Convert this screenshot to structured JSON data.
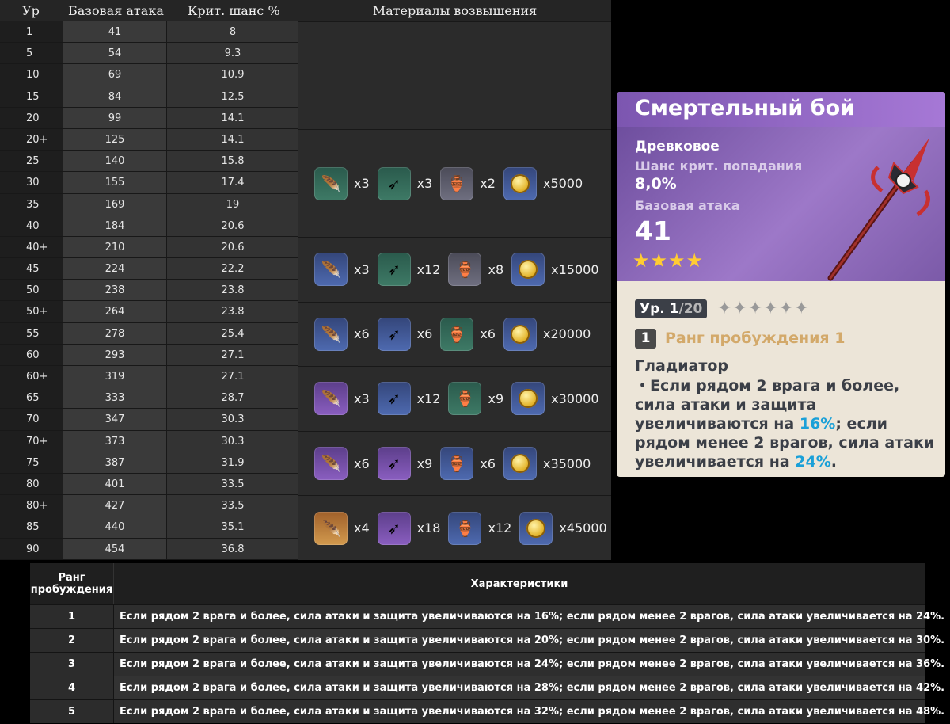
{
  "stats": {
    "headers": {
      "level": "Ур",
      "atk": "Базовая атака",
      "crit": "Крит. шанс %",
      "mats": "Материалы возвышения"
    },
    "rows": [
      {
        "lvl": "1",
        "atk": "41",
        "crit": "8"
      },
      {
        "lvl": "5",
        "atk": "54",
        "crit": "9.3"
      },
      {
        "lvl": "10",
        "atk": "69",
        "crit": "10.9"
      },
      {
        "lvl": "15",
        "atk": "84",
        "crit": "12.5"
      },
      {
        "lvl": "20",
        "atk": "99",
        "crit": "14.1"
      },
      {
        "lvl": "20+",
        "atk": "125",
        "crit": "14.1"
      },
      {
        "lvl": "25",
        "atk": "140",
        "crit": "15.8"
      },
      {
        "lvl": "30",
        "atk": "155",
        "crit": "17.4"
      },
      {
        "lvl": "35",
        "atk": "169",
        "crit": "19"
      },
      {
        "lvl": "40",
        "atk": "184",
        "crit": "20.6"
      },
      {
        "lvl": "40+",
        "atk": "210",
        "crit": "20.6"
      },
      {
        "lvl": "45",
        "atk": "224",
        "crit": "22.2"
      },
      {
        "lvl": "50",
        "atk": "238",
        "crit": "23.8"
      },
      {
        "lvl": "50+",
        "atk": "264",
        "crit": "23.8"
      },
      {
        "lvl": "55",
        "atk": "278",
        "crit": "25.4"
      },
      {
        "lvl": "60",
        "atk": "293",
        "crit": "27.1"
      },
      {
        "lvl": "60+",
        "atk": "319",
        "crit": "27.1"
      },
      {
        "lvl": "65",
        "atk": "333",
        "crit": "28.7"
      },
      {
        "lvl": "70",
        "atk": "347",
        "crit": "30.3"
      },
      {
        "lvl": "70+",
        "atk": "373",
        "crit": "30.3"
      },
      {
        "lvl": "75",
        "atk": "387",
        "crit": "31.9"
      },
      {
        "lvl": "80",
        "atk": "401",
        "crit": "33.5"
      },
      {
        "lvl": "80+",
        "atk": "427",
        "crit": "33.5"
      },
      {
        "lvl": "85",
        "atk": "440",
        "crit": "35.1"
      },
      {
        "lvl": "90",
        "atk": "454",
        "crit": "36.8"
      }
    ],
    "material_groups": [
      {
        "rows": 5,
        "items": []
      },
      {
        "rows": 5,
        "items": [
          {
            "icon": "horn-icon",
            "rarity": "r2",
            "glyph": "🪶",
            "count": "x3"
          },
          {
            "icon": "arrowhead-icon",
            "rarity": "r2",
            "glyph": "➶",
            "count": "x3"
          },
          {
            "icon": "mask-icon",
            "rarity": "r1",
            "glyph": "🏺",
            "count": "x2"
          },
          {
            "icon": "mora-coin-icon",
            "rarity": "r3",
            "glyph": "●",
            "count": "x5000"
          }
        ]
      },
      {
        "rows": 3,
        "items": [
          {
            "icon": "horn-icon",
            "rarity": "r3",
            "glyph": "🪶",
            "count": "x3"
          },
          {
            "icon": "arrowhead-icon",
            "rarity": "r2",
            "glyph": "➶",
            "count": "x12"
          },
          {
            "icon": "mask-icon",
            "rarity": "r1",
            "glyph": "🏺",
            "count": "x8"
          },
          {
            "icon": "mora-coin-icon",
            "rarity": "r3",
            "glyph": "●",
            "count": "x15000"
          }
        ]
      },
      {
        "rows": 3,
        "items": [
          {
            "icon": "horn-icon",
            "rarity": "r3",
            "glyph": "🪶",
            "count": "x6"
          },
          {
            "icon": "arrowhead-icon",
            "rarity": "r3",
            "glyph": "➶",
            "count": "x6"
          },
          {
            "icon": "mask-icon",
            "rarity": "r2",
            "glyph": "🏺",
            "count": "x6"
          },
          {
            "icon": "mora-coin-icon",
            "rarity": "r3",
            "glyph": "●",
            "count": "x20000"
          }
        ]
      },
      {
        "rows": 3,
        "items": [
          {
            "icon": "horn-icon",
            "rarity": "r4",
            "glyph": "🪶",
            "count": "x3"
          },
          {
            "icon": "arrowhead-icon",
            "rarity": "r3",
            "glyph": "➶",
            "count": "x12"
          },
          {
            "icon": "mask-icon",
            "rarity": "r2",
            "glyph": "🏺",
            "count": "x9"
          },
          {
            "icon": "mora-coin-icon",
            "rarity": "r3",
            "glyph": "●",
            "count": "x30000"
          }
        ]
      },
      {
        "rows": 3,
        "items": [
          {
            "icon": "horn-icon",
            "rarity": "r4",
            "glyph": "🪶",
            "count": "x6"
          },
          {
            "icon": "arrowhead-icon",
            "rarity": "r4",
            "glyph": "➶",
            "count": "x9"
          },
          {
            "icon": "mask-icon",
            "rarity": "r3",
            "glyph": "🏺",
            "count": "x6"
          },
          {
            "icon": "mora-coin-icon",
            "rarity": "r3",
            "glyph": "●",
            "count": "x35000"
          }
        ]
      },
      {
        "rows": 3,
        "items": [
          {
            "icon": "horn-icon",
            "rarity": "r5",
            "glyph": "🪶",
            "count": "x4"
          },
          {
            "icon": "arrowhead-icon",
            "rarity": "r4",
            "glyph": "➶",
            "count": "x18"
          },
          {
            "icon": "mask-icon",
            "rarity": "r3",
            "glyph": "🏺",
            "count": "x12"
          },
          {
            "icon": "mora-coin-icon",
            "rarity": "r3",
            "glyph": "●",
            "count": "x45000"
          }
        ]
      }
    ]
  },
  "card": {
    "title": "Смертельный бой",
    "type": "Древковое",
    "crit_label": "Шанс крит. попадания",
    "crit_value": "8,0%",
    "atk_label": "Базовая атака",
    "atk_value": "41",
    "stars": "★★★★",
    "level_prefix": "Ур. 1",
    "level_max": "/20",
    "ascension_stars": "✦✦✦✦✦✦",
    "rank_num": "1",
    "rank_label": "Ранг пробуждения 1",
    "passive_name": "Гладиатор",
    "passive_text_1": "・Если рядом 2 врага и более, сила атаки и защита увеличиваются на ",
    "passive_hl_1": "16%",
    "passive_text_2": "; если рядом менее 2 врагов, сила атаки увеличивается на ",
    "passive_hl_2": "24%",
    "passive_text_3": ".",
    "colors": {
      "header": "#a678d6",
      "highlight": "#1aa0d8",
      "stars": "#ffcc33",
      "rank": "#d3a96a"
    }
  },
  "refine": {
    "headers": {
      "rank": "Ранг пробуждения",
      "desc": "Характеристики"
    },
    "rows": [
      {
        "rank": "1",
        "desc": "Если рядом 2 врага и более, сила атаки и защита увеличиваются на 16%; если рядом менее 2 врагов, сила атаки увеличивается на 24%."
      },
      {
        "rank": "2",
        "desc": "Если рядом 2 врага и более, сила атаки и защита увеличиваются на 20%; если рядом менее 2 врагов, сила атаки увеличивается на 30%."
      },
      {
        "rank": "3",
        "desc": "Если рядом 2 врага и более, сила атаки и защита увеличиваются на 24%; если рядом менее 2 врагов, сила атаки увеличивается на 36%."
      },
      {
        "rank": "4",
        "desc": "Если рядом 2 врага и более, сила атаки и защита увеличиваются на 28%; если рядом менее 2 врагов, сила атаки увеличивается на 42%."
      },
      {
        "rank": "5",
        "desc": "Если рядом 2 врага и более, сила атаки и защита увеличиваются на 32%; если рядом менее 2 врагов, сила атаки увеличивается на 48%."
      }
    ]
  }
}
